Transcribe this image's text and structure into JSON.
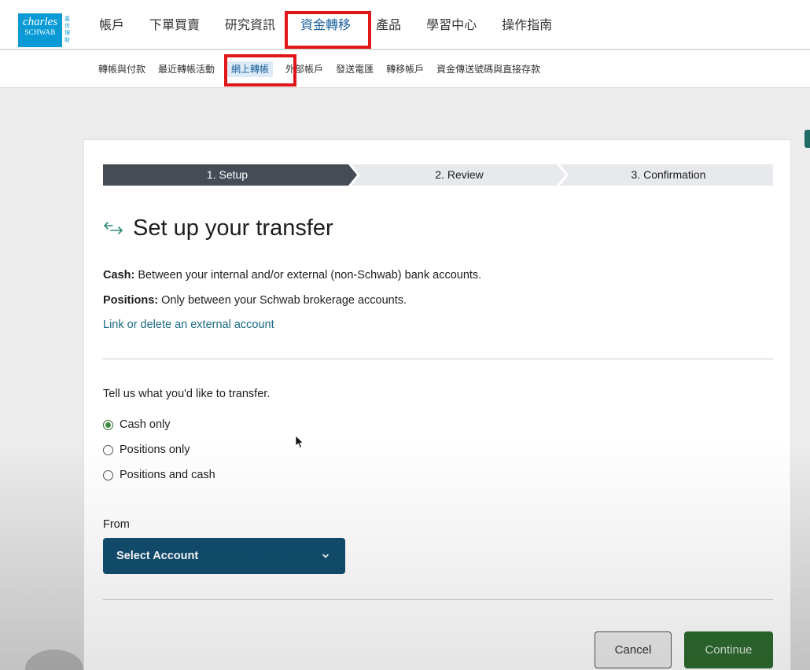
{
  "header": {
    "logo_line1": "charles",
    "logo_line2": "SCHWAB",
    "logo_cjk": "嘉信理財",
    "nav": [
      "帳戶",
      "下單買賣",
      "研究資訊",
      "資金轉移",
      "產品",
      "學習中心",
      "操作指南"
    ],
    "active_nav": "資金轉移"
  },
  "subnav": {
    "items": [
      "轉帳與付款",
      "最近轉帳活動",
      "網上轉帳",
      "外部帳戶",
      "發送電匯",
      "轉移帳戶",
      "資金傳送號碼與直接存款"
    ],
    "active": "網上轉帳"
  },
  "steps": [
    "1. Setup",
    "2. Review",
    "3. Confirmation"
  ],
  "active_step": 0,
  "page": {
    "title": "Set up your transfer",
    "cash_label": "Cash:",
    "cash_text": " Between your internal and/or external (non-Schwab) bank accounts.",
    "positions_label": "Positions:",
    "positions_text": " Only between your Schwab brokerage accounts.",
    "link_text": "Link or delete an external account"
  },
  "transfer": {
    "question": "Tell us what you'd like to transfer.",
    "options": [
      "Cash only",
      "Positions only",
      "Positions and cash"
    ],
    "selected": "Cash only"
  },
  "from": {
    "label": "From",
    "select_label": "Select Account"
  },
  "buttons": {
    "cancel": "Cancel",
    "continue": "Continue"
  },
  "colors": {
    "step_active": "#454c56",
    "step_inactive": "#e7e9ec",
    "select_bg": "#124d6f",
    "continue_bg": "#2d6a2f",
    "highlight": "#e0161b",
    "link": "#1a6a83"
  }
}
